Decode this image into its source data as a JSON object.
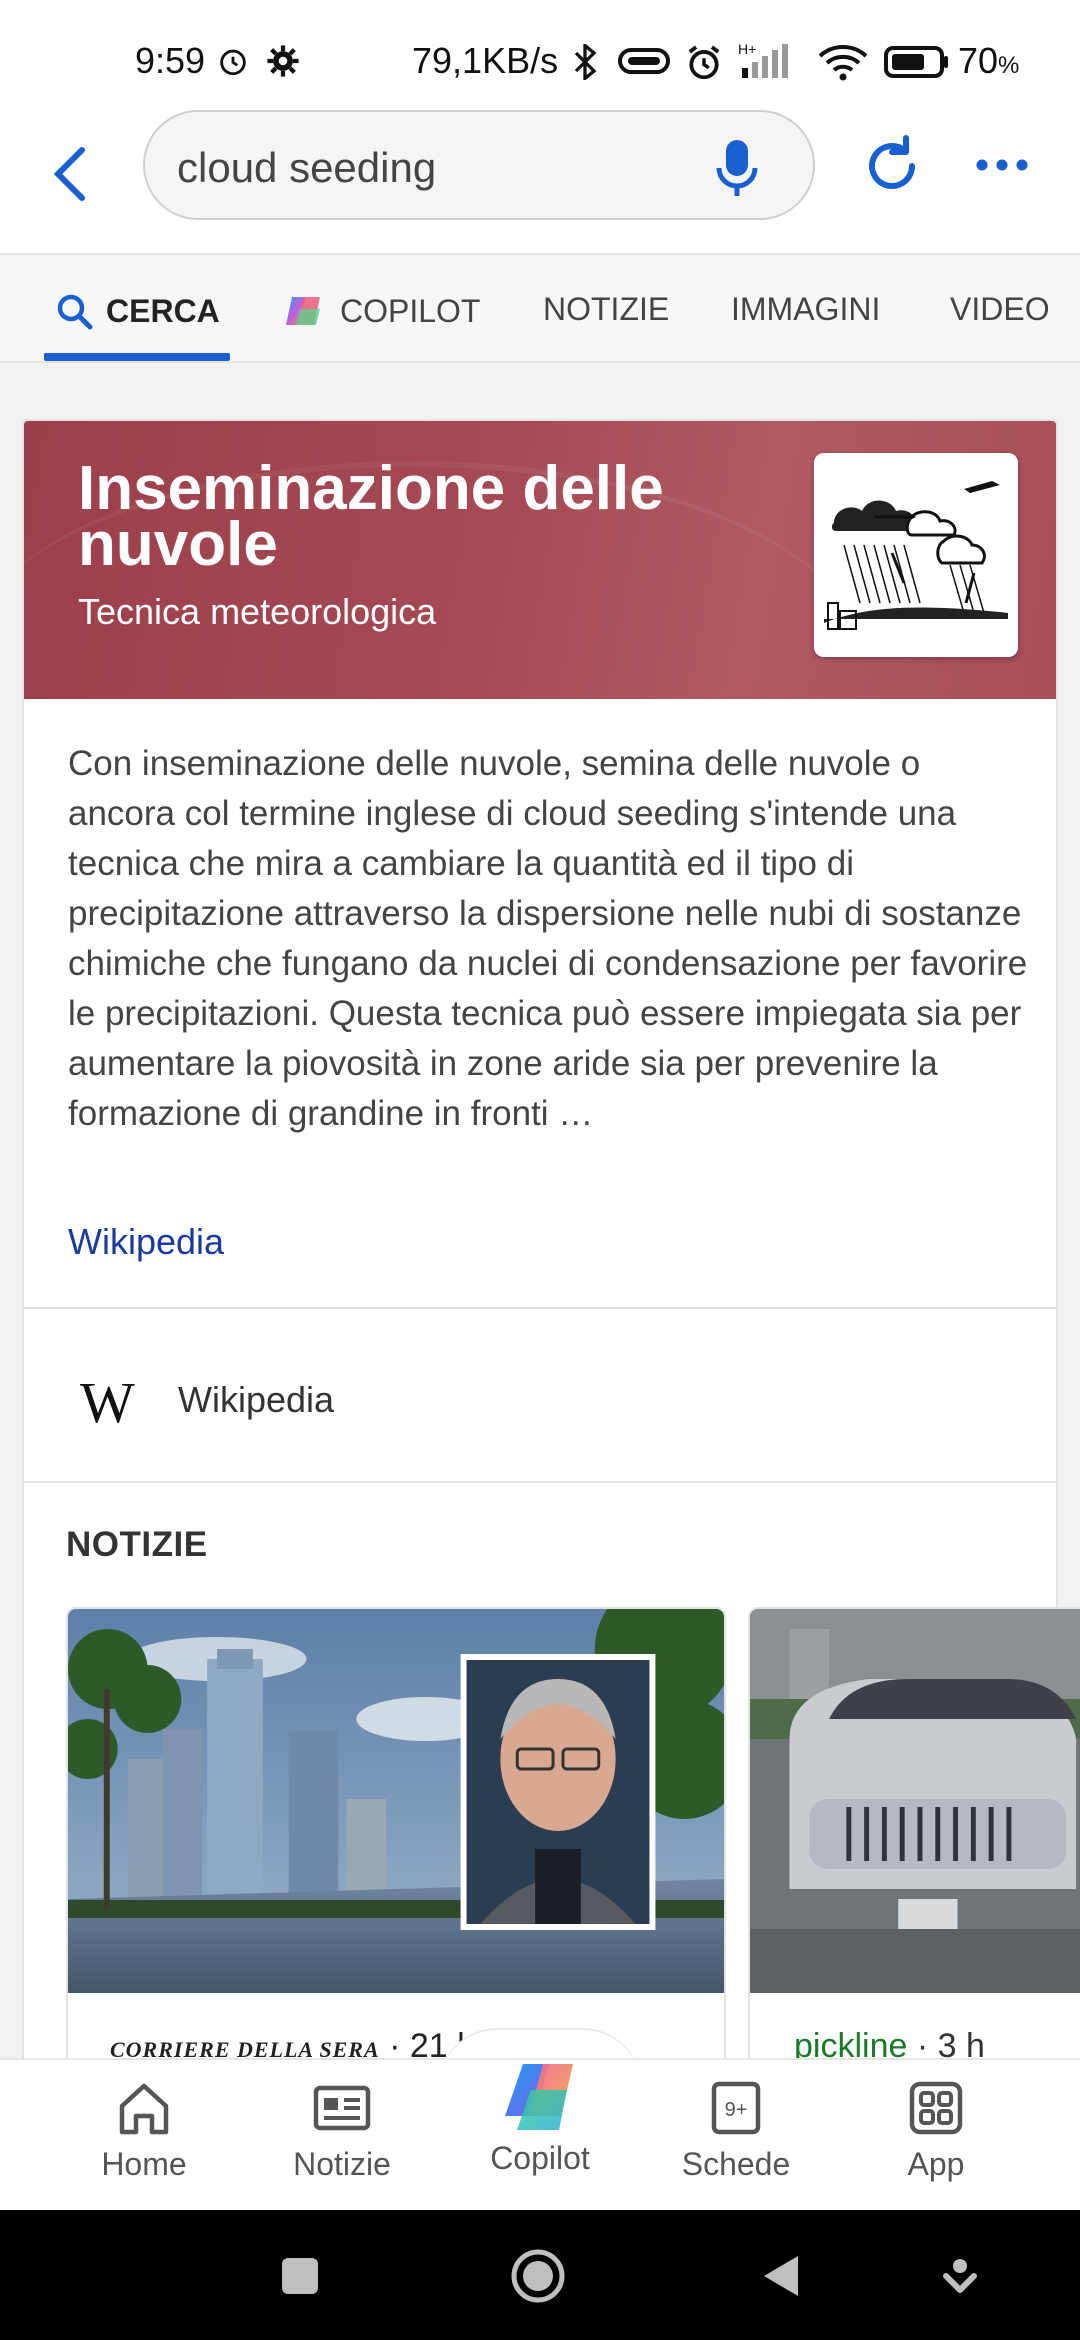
{
  "status_bar": {
    "time": "9:59",
    "speed": "79,1KB/s",
    "network": "H+",
    "battery": "70",
    "battery_unit": "%"
  },
  "search": {
    "query": "cloud seeding"
  },
  "tabs": [
    {
      "label": "CERCA",
      "icon": "search-icon",
      "active": true
    },
    {
      "label": "COPILOT",
      "icon": "copilot-icon",
      "active": false
    },
    {
      "label": "NOTIZIE",
      "active": false
    },
    {
      "label": "IMMAGINI",
      "active": false
    },
    {
      "label": "VIDEO",
      "active": false
    }
  ],
  "entity": {
    "title": "Inseminazione delle nuvole",
    "subtitle": "Tecnica meteorologica",
    "description": "Con inseminazione delle nuvole, semina delle nuvole o ancora col termine inglese di cloud seeding s'intende una tecnica che mira a cambiare la quantità ed il tipo di precipitazione attraverso la dispersione nelle nubi di sostanze chimiche che fungano da nuclei di condensazione per favorire le precipitazioni. Questa tecnica può essere impiegata sia per aumentare la piovosità in zone aride sia per prevenire la formazione di grandine in fronti …",
    "source_link": "Wikipedia",
    "hero_color": "#a3454f"
  },
  "source_row": {
    "logo": "W",
    "label": "Wikipedia"
  },
  "news": {
    "heading": "NOTIZIE",
    "items": [
      {
        "source": "CORRIERE DELLA SERA",
        "time": "21 h"
      },
      {
        "source": "pickline",
        "time": "3 h"
      }
    ]
  },
  "bottom_nav": [
    {
      "label": "Home",
      "icon": "home-icon"
    },
    {
      "label": "Notizie",
      "icon": "news-icon"
    },
    {
      "label": "Copilot",
      "icon": "copilot-icon"
    },
    {
      "label": "Schede",
      "icon": "tabs-icon",
      "badge": "9+"
    },
    {
      "label": "App",
      "icon": "apps-grid-icon"
    }
  ],
  "colors": {
    "accent": "#1a5fd0",
    "link": "#1a3aa0",
    "news_source_green": "#1a7a2a"
  }
}
